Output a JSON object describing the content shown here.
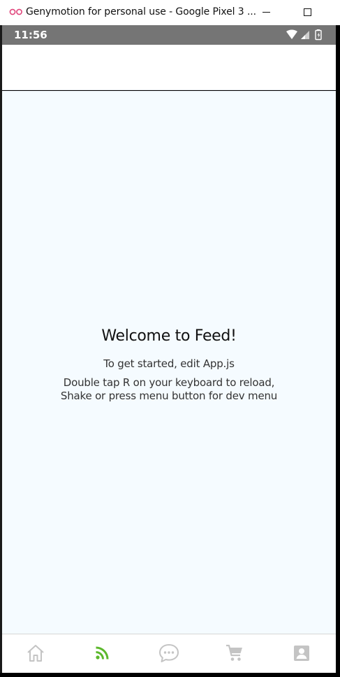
{
  "window": {
    "title": "Genymotion for personal use - Google Pixel 3 ..."
  },
  "status_bar": {
    "time": "11:56"
  },
  "content": {
    "heading": "Welcome to Feed!",
    "instructions": "To get started, edit App.js",
    "reload_line1": "Double tap R on your keyboard to reload,",
    "reload_line2": "Shake or press menu button for dev menu"
  },
  "tabbar": {
    "active_tab": "feed",
    "active_color": "#5cb82c",
    "inactive_color": "#c4c4c4",
    "tabs": [
      {
        "id": "home",
        "icon": "home-icon"
      },
      {
        "id": "feed",
        "icon": "rss-feed-icon"
      },
      {
        "id": "chat",
        "icon": "chat-bubble-icon"
      },
      {
        "id": "cart",
        "icon": "shopping-cart-icon"
      },
      {
        "id": "profile",
        "icon": "account-box-icon"
      }
    ]
  },
  "colors": {
    "status_bar_bg": "#757575",
    "content_bg": "#f5fbff",
    "genymotion_logo": "#e0457b"
  }
}
